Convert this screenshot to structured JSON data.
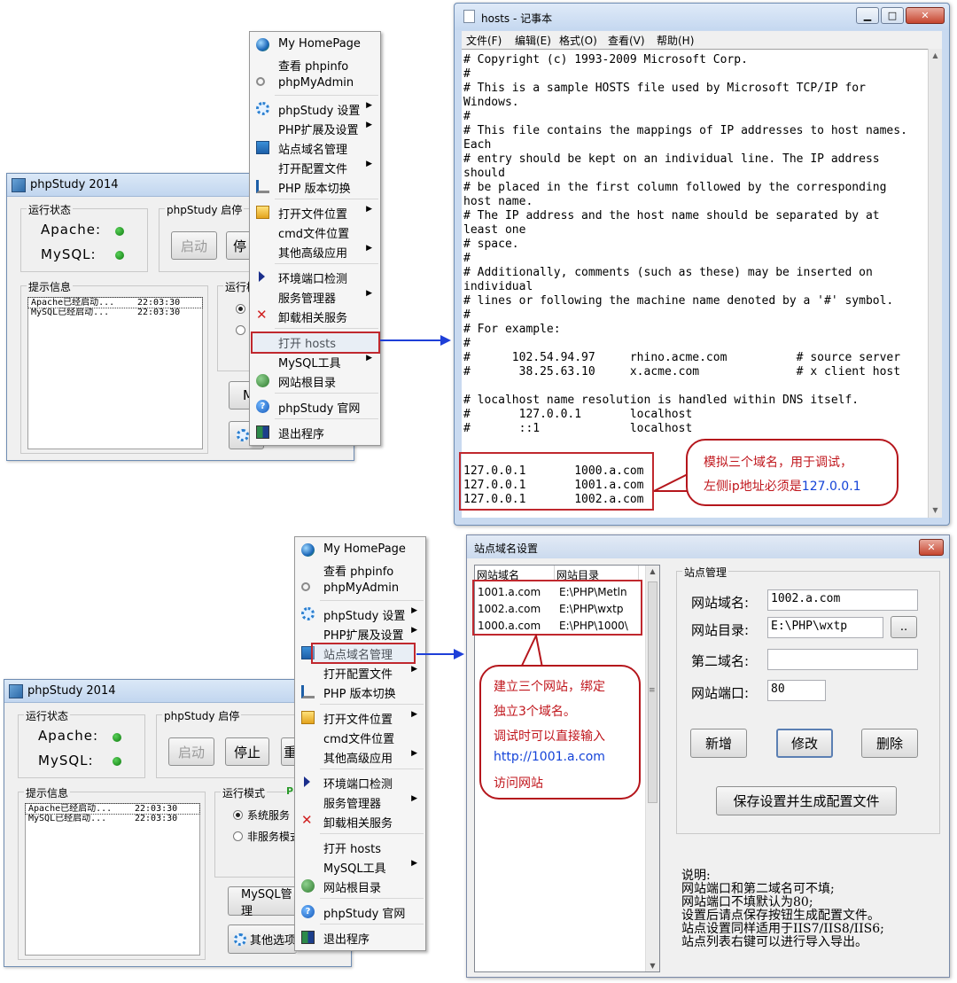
{
  "phpstudy_top": {
    "title": "phpStudy 2014",
    "status_group": "运行状态",
    "apache": "Apache:",
    "mysql": "MySQL:",
    "control_group": "phpStudy 启停",
    "start_button": "启动",
    "stop_button_partial": "停",
    "log_group": "提示信息",
    "log": [
      {
        "text": "Apache已经启动...",
        "time": "22:03:30"
      },
      {
        "text": "MySQL已经启动...",
        "time": "22:03:30"
      }
    ],
    "mode_group_partial": "运行模",
    "mysql_button_partial": "M",
    "led_color": "#1aa01a"
  },
  "menu_top": {
    "items": [
      {
        "label": "My HomePage",
        "icon": "globe-icon"
      },
      {
        "label": "查看 phpinfo",
        "icon": ""
      },
      {
        "label": "phpMyAdmin",
        "icon": "link-icon"
      },
      {
        "label": "phpStudy 设置",
        "icon": "gear-icon",
        "submenu": true
      },
      {
        "label": "PHP扩展及设置",
        "icon": "",
        "submenu": true
      },
      {
        "label": "站点域名管理",
        "icon": "network-icon"
      },
      {
        "label": "打开配置文件",
        "icon": "",
        "submenu": true
      },
      {
        "label": "PHP 版本切换",
        "icon": "switch-icon"
      },
      {
        "label": "打开文件位置",
        "icon": "folder-icon",
        "submenu": true
      },
      {
        "label": "cmd文件位置",
        "icon": ""
      },
      {
        "label": "其他高级应用",
        "icon": "",
        "submenu": true
      },
      {
        "label": "环境端口检测",
        "icon": "triangle-icon"
      },
      {
        "label": "服务管理器",
        "icon": "",
        "submenu": true
      },
      {
        "label": "卸载相关服务",
        "icon": "uninstall-icon"
      },
      {
        "label": "打开 hosts",
        "icon": ""
      },
      {
        "label": "MySQL工具",
        "icon": "",
        "submenu": true
      },
      {
        "label": "网站根目录",
        "icon": "earth-icon"
      },
      {
        "label": "phpStudy 官网",
        "icon": "help-icon"
      },
      {
        "label": "退出程序",
        "icon": "exit-icon"
      }
    ],
    "highlighted": "打开 hosts"
  },
  "notepad": {
    "title": "hosts - 记事本",
    "menus": [
      "文件(F)",
      "编辑(E)",
      "格式(O)",
      "查看(V)",
      "帮助(H)"
    ],
    "lines": [
      "# Copyright (c) 1993-2009 Microsoft Corp.",
      "#",
      "# This is a sample HOSTS file used by Microsoft TCP/IP for",
      "Windows.",
      "#",
      "# This file contains the mappings of IP addresses to host names.",
      "Each",
      "# entry should be kept on an individual line. The IP address",
      "should",
      "# be placed in the first column followed by the corresponding",
      "host name.",
      "# The IP address and the host name should be separated by at",
      "least one",
      "# space.",
      "#",
      "# Additionally, comments (such as these) may be inserted on",
      "individual",
      "# lines or following the machine name denoted by a '#' symbol.",
      "#",
      "# For example:",
      "#",
      "#      102.54.94.97     rhino.acme.com          # source server",
      "#       38.25.63.10     x.acme.com              # x client host",
      "",
      "# localhost name resolution is handled within DNS itself.",
      "#       127.0.0.1       localhost",
      "#       ::1             localhost",
      "",
      "",
      "127.0.0.1       1000.a.com",
      "127.0.0.1       1001.a.com",
      "127.0.0.1       1002.a.com"
    ]
  },
  "callout_hosts": {
    "line1": "模拟三个域名，用于调试，",
    "line2a": "左侧ip地址必须是",
    "line2b": "127.0.0.1"
  },
  "phpstudy_bottom": {
    "title": "phpStudy 2014",
    "status_group": "运行状态",
    "apache": "Apache:",
    "mysql": "MySQL:",
    "control_group": "phpStudy 启停",
    "start_button": "启动",
    "stop_button": "停止",
    "restart_partial": "重",
    "log_group": "提示信息",
    "log": [
      {
        "text": "Apache已经启动...",
        "time": "22:03:30"
      },
      {
        "text": "MySQL已经启动...",
        "time": "22:03:30"
      }
    ],
    "mode_group": "运行模式",
    "mode_green_partial": "P",
    "radio_system": "系统服务",
    "radio_nonservice": "非服务模式",
    "mysql_manage_button": "MySQL管理",
    "other_options_button": "其他选项"
  },
  "menu_bottom": {
    "highlighted": "站点域名管理"
  },
  "site_dialog": {
    "title": "站点域名设置",
    "columns": [
      "网站域名",
      "网站目录"
    ],
    "rows": [
      {
        "domain": "1001.a.com",
        "dir": "E:\\PHP\\Metln"
      },
      {
        "domain": "1002.a.com",
        "dir": "E:\\PHP\\wxtp"
      },
      {
        "domain": "1000.a.com",
        "dir": "E:\\PHP\\1000\\"
      }
    ],
    "group_title": "站点管理",
    "domain_label": "网站域名:",
    "domain_value": "1002.a.com",
    "dir_label": "网站目录:",
    "dir_value": "E:\\PHP\\wxtp",
    "browse_button": "..",
    "second_label": "第二域名:",
    "second_value": "",
    "port_label": "网站端口:",
    "port_value": "80",
    "add_button": "新增",
    "modify_button": "修改",
    "delete_button": "删除",
    "save_button": "保存设置并生成配置文件",
    "notes": [
      "说明:",
      "网站端口和第二域名可不填;",
      "网站端口不填默认为80;",
      "设置后请点保存按钮生成配置文件。",
      "站点设置同样适用于IIS7/IIS8/IIS6;",
      "站点列表右键可以进行导入导出。"
    ]
  },
  "callout_sites": {
    "line1": "建立三个网站，绑定",
    "line2": "独立3个域名。",
    "line3": "调试时可以直接输入",
    "line4": "http://1001.a.com",
    "line5": "访问网站"
  }
}
